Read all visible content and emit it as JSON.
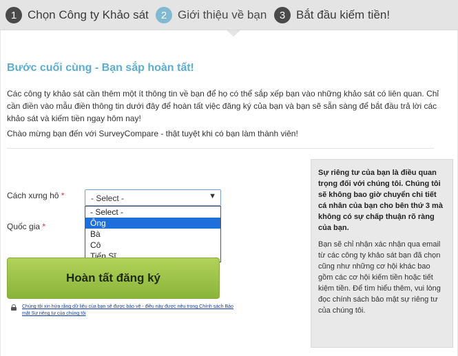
{
  "steps": [
    {
      "number": "1",
      "label": "Chọn Công ty Khảo sát",
      "active": false
    },
    {
      "number": "2",
      "label": "Giới thiệu về bạn",
      "active": true
    },
    {
      "number": "3",
      "label": "Bắt đầu kiếm tiền!",
      "active": false
    }
  ],
  "form": {
    "heading": "Bước cuối cùng - Bạn sắp hoàn tất!",
    "intro": "Các công ty khảo sát cần thêm một ít thông tin về bạn để họ có thể sắp xếp bạn vào những khảo sát có liên quan. Chỉ cần điền vào mẫu điền thông tin dưới đây để hoàn tất việc đăng ký của bạn và bạn sẽ sẵn sàng để bắt đầu trả lời các khảo sát và kiếm tiền ngay hôm nay!",
    "welcome": "Chào mừng bạn đến với SurveyCompare - thật tuyệt khi có bạn làm thành viên!",
    "title_label": "Cách xưng hô",
    "country_label": "Quốc gia",
    "required_marker": "*",
    "title_select": {
      "value": "- Select -",
      "arrow": "▼",
      "options": [
        "- Select -",
        "Ông",
        "Bà",
        "Cô",
        "Tiến Sĩ"
      ],
      "highlighted": "Ông"
    },
    "submit_label": "Hoàn tất đăng ký",
    "privacy_link": "Chúng tôi xin hứa rằng dữ liệu của bạn sẽ được bảo vệ - điều này được nêu trong Chính sách Bảo mật Sự riêng tư của chúng tôi"
  },
  "sidebar": {
    "bold_text": "Sự riêng tư của bạn là điều quan trọng đối với chúng tôi. Chúng tôi sẽ không bao giờ chuyển chi tiết cá nhân của bạn cho bên thứ 3 mà không có sự chấp thuận rõ ràng của bạn.",
    "body_text": "Bạn sẽ chỉ nhận xác nhận qua email từ các công ty khảo sát bạn đã chọn cũng như những cơ hội khác bao gồm các cơ hội kiếm tiền hoặc tiết kiệm tiền. Để tìm hiểu thêm, vui lòng đọc chính sách bảo mật sự riêng tư của chúng tôi."
  },
  "colors": {
    "heading": "#5aaed1",
    "active_step": "#7fb9d2",
    "submit_button": "#9fc44a",
    "highlight": "#1e6fd9"
  }
}
